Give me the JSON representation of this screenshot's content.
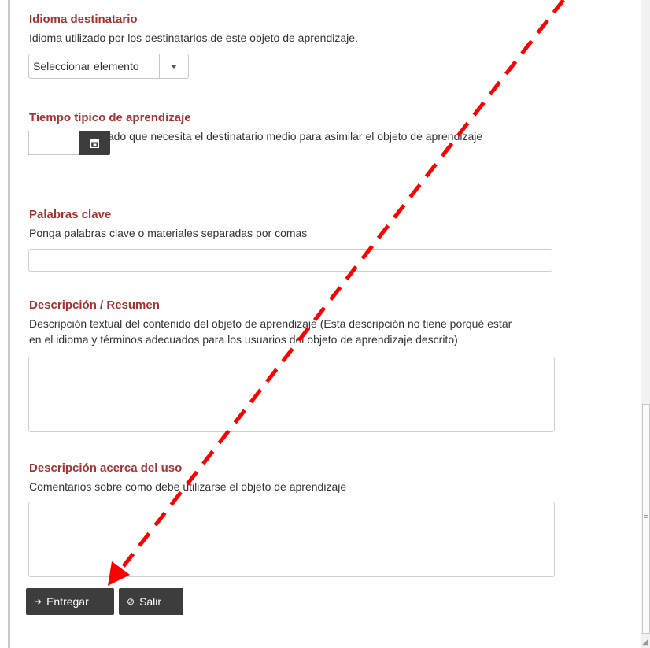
{
  "fields": {
    "target_language": {
      "label": "Idioma destinatario",
      "description": "Idioma utilizado por los destinatarios de este objeto de aprendizaje.",
      "select_value": "Seleccionar elemento"
    },
    "learning_time": {
      "label": "Tiempo típico de aprendizaje",
      "description": "Tiempo aproximado que necesita el destinatario medio para asimilar el objeto de aprendizaje",
      "value": ""
    },
    "keywords": {
      "label": "Palabras clave",
      "description": "Ponga palabras clave o materiales separadas por comas",
      "value": ""
    },
    "summary": {
      "label": "Descripción / Resumen",
      "description_line1": "Descripción textual del contenido del objeto de aprendizaje (Esta descripción no tiene porqué estar",
      "description_line2": "en el idioma y términos adecuados para los usuarios del objeto de aprendizaje descrito)",
      "value": ""
    },
    "usage": {
      "label": "Descripción acerca del uso",
      "description": "Comentarios sobre como debe utilizarse el objeto de aprendizaje",
      "value": ""
    }
  },
  "buttons": {
    "submit_label": "Entregar",
    "submit_icon": "arrow-right-icon",
    "exit_label": "Salir",
    "exit_icon": "ban-icon"
  },
  "icons": {
    "calendar": "calendar-icon",
    "dropdown": "chevron-down-icon"
  },
  "colors": {
    "heading": "#a83232",
    "button_bg": "#3d3d3d",
    "annotation_arrow": "#ff0000"
  }
}
